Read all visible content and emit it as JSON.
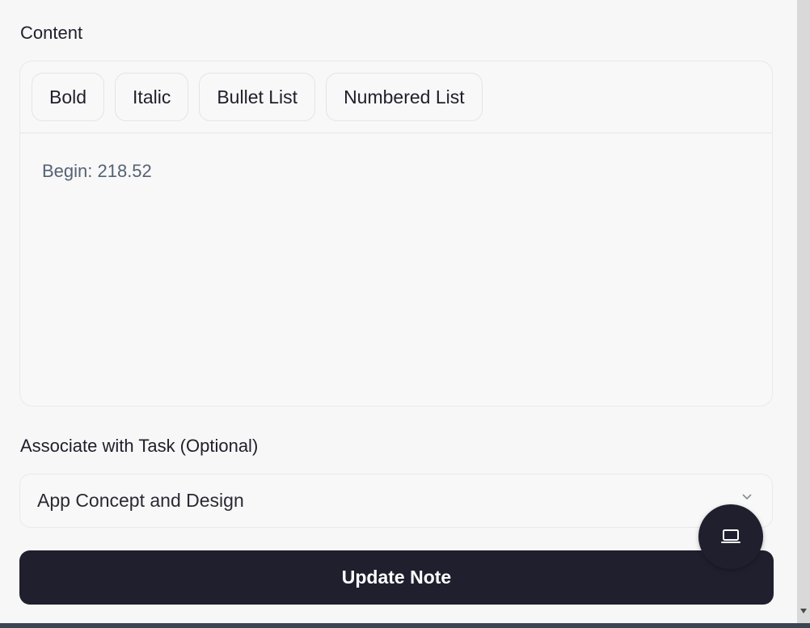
{
  "content_section": {
    "label": "Content"
  },
  "toolbar": {
    "bold": "Bold",
    "italic": "Italic",
    "bullet_list": "Bullet List",
    "numbered_list": "Numbered List"
  },
  "editor": {
    "text": "Begin: 218.52"
  },
  "task_section": {
    "label": "Associate with Task (Optional)",
    "selected": "App Concept and Design"
  },
  "actions": {
    "update_label": "Update Note"
  },
  "icons": {
    "fab": "laptop-icon",
    "select": "chevron-down-icon"
  }
}
